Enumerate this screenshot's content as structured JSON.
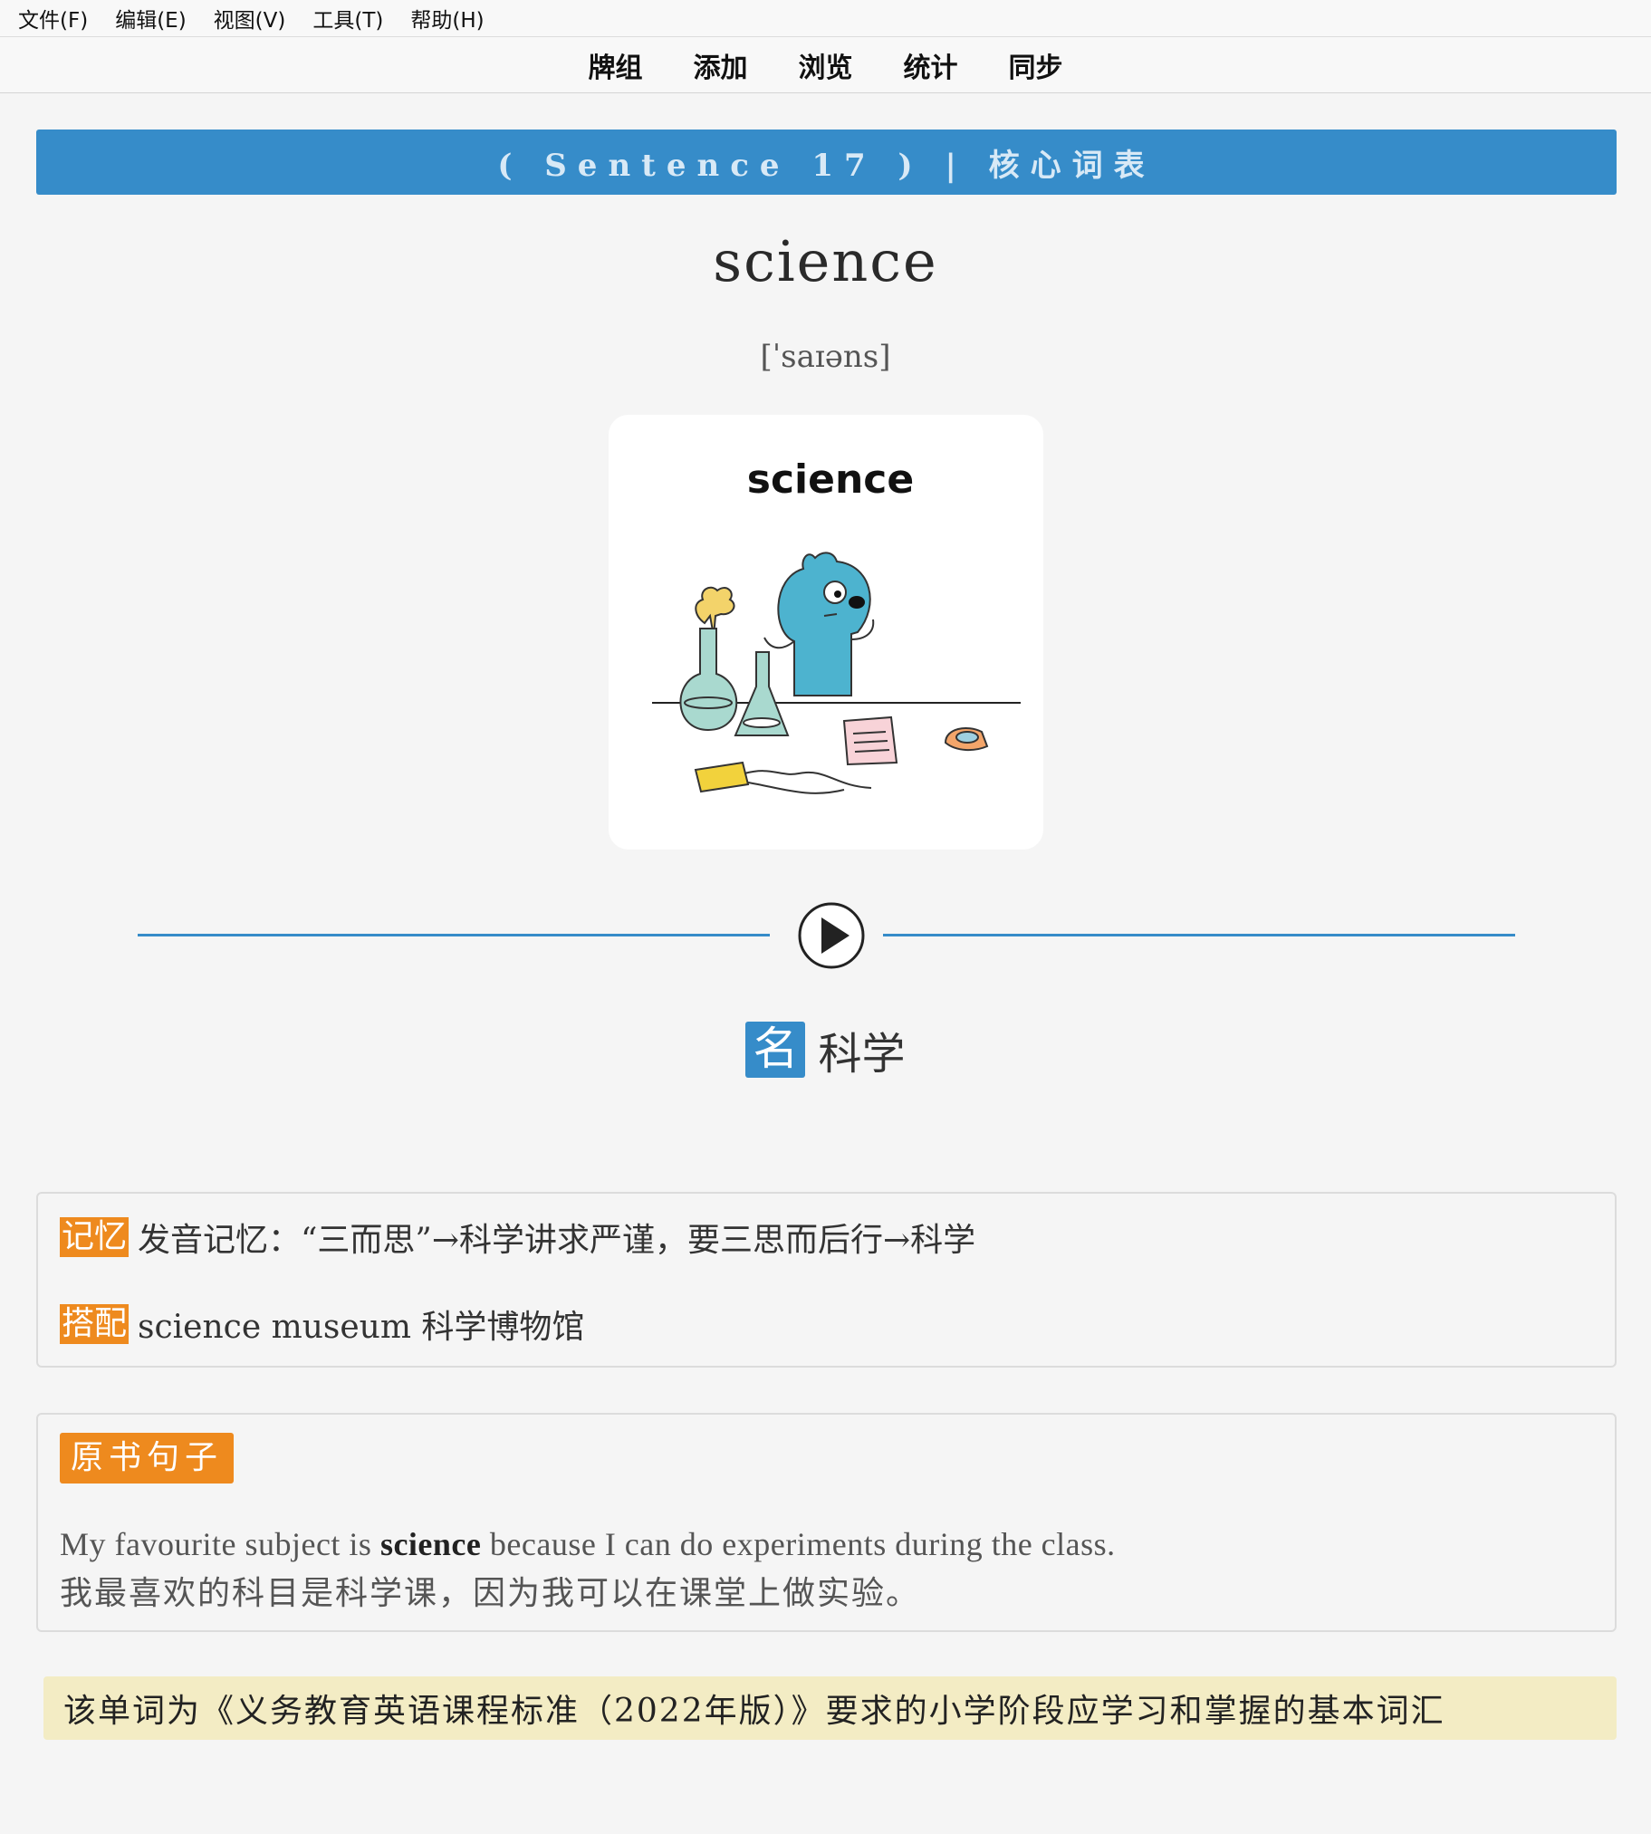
{
  "menu": {
    "items": [
      "文件(F)",
      "编辑(E)",
      "视图(V)",
      "工具(T)",
      "帮助(H)"
    ]
  },
  "toolbar": {
    "items": [
      "牌组",
      "添加",
      "浏览",
      "统计",
      "同步"
    ]
  },
  "banner": {
    "text": "( Sentence 17 ) | 核心词表"
  },
  "card": {
    "word": "science",
    "phonetic": "[ˈsaɪəns]",
    "image_caption": "science",
    "part_of_speech": "名",
    "meaning": "科学"
  },
  "memory": {
    "tag1": "记忆",
    "text1": "发音记忆：“三而思”→科学讲求严谨，要三思而后行→科学",
    "tag2": "搭配",
    "text2": "science museum 科学博物馆"
  },
  "example": {
    "tag": "原书句子",
    "en_before": "My favourite subject is ",
    "en_word": "science",
    "en_after": " because I can do experiments during the class.",
    "zh": "我最喜欢的科目是科学课，因为我可以在课堂上做实验。"
  },
  "note": {
    "text": "该单词为《义务教育英语课程标准（2022年版）》要求的小学阶段应学习和掌握的基本词汇"
  },
  "colors": {
    "accent": "#368cc9",
    "tag": "#ee8a1e",
    "note_bg": "#f3ecc4"
  }
}
